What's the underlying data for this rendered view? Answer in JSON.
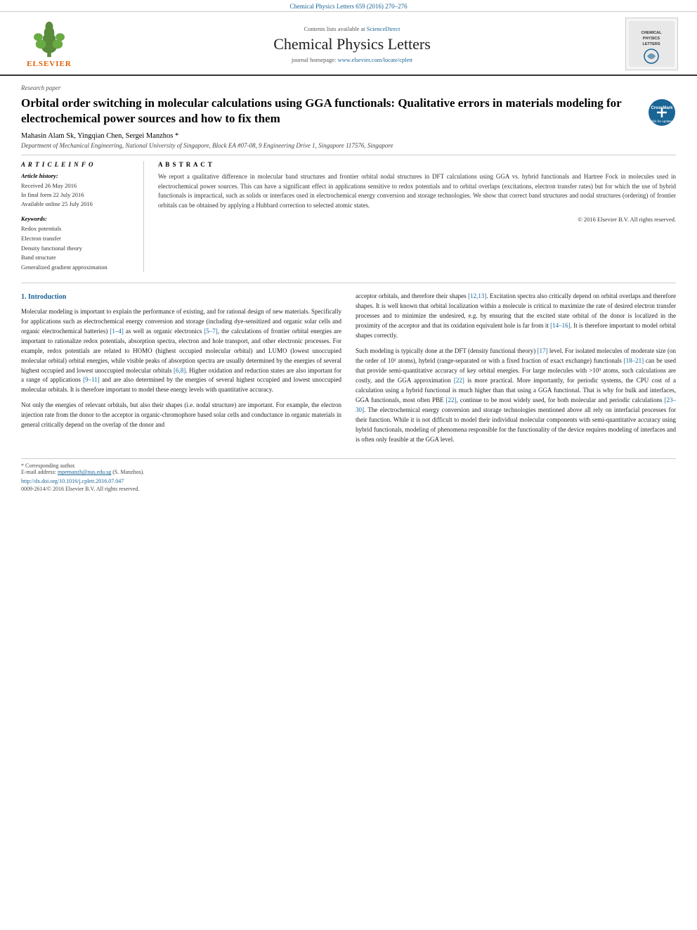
{
  "top_bar": {
    "journal_ref": "Chemical Physics Letters 659 (2016) 270–276"
  },
  "journal_header": {
    "contents_note": "Contents lists available at",
    "science_direct_link": "ScienceDirect",
    "journal_title": "Chemical Physics Letters",
    "homepage_label": "journal homepage:",
    "homepage_url": "www.elsevier.com/locate/cplett",
    "elsevier_brand": "ELSEVIER",
    "logo_alt": "CHEMICAL PHYSICS LETTERS"
  },
  "article": {
    "paper_type": "Research paper",
    "title": "Orbital order switching in molecular calculations using GGA functionals: Qualitative errors in materials modeling for electrochemical power sources and how to fix them",
    "authors": "Mahasin Alam Sk, Yingqian Chen, Sergei Manzhos *",
    "affiliation": "Department of Mechanical Engineering, National University of Singapore, Block EA #07-08, 9 Engineering Drive 1, Singapore 117576, Singapore"
  },
  "article_info": {
    "heading": "A R T I C L E   I N F O",
    "history_label": "Article history:",
    "received": "Received 26 May 2016",
    "final_form": "In final form 22 July 2016",
    "available": "Available online 25 July 2016",
    "keywords_label": "Keywords:",
    "keywords": [
      "Redox potentials",
      "Electron transfer",
      "Density functional theory",
      "Band structure",
      "Generalized gradient approximation"
    ]
  },
  "abstract": {
    "heading": "A B S T R A C T",
    "text": "We report a qualitative difference in molecular band structures and frontier orbital nodal structures in DFT calculations using GGA vs. hybrid functionals and Hartree Fock in molecules used in electrochemical power sources. This can have a significant effect in applications sensitive to redox potentials and to orbital overlaps (excitations, electron transfer rates) but for which the use of hybrid functionals is impractical, such as solids or interfaces used in electrochemical energy conversion and storage technologies. We show that correct band structures and nodal structures (ordering) of frontier orbitals can be obtained by applying a Hubbard correction to selected atomic states.",
    "copyright": "© 2016 Elsevier B.V. All rights reserved."
  },
  "body": {
    "section1_title": "1. Introduction",
    "col1_paragraphs": [
      "Molecular modeling is important to explain the performance of existing, and for rational design of new materials. Specifically for applications such as electrochemical energy conversion and storage (including dye-sensitized and organic solar cells and organic electrochemical batteries) [1–4] as well as organic electronics [5–7], the calculations of frontier orbital energies are important to rationalize redox potentials, absorption spectra, electron and hole transport, and other electronic processes. For example, redox potentials are related to HOMO (highest occupied molecular orbital) and LUMO (lowest unoccupied molecular orbital) orbital energies, while visible peaks of absorption spectra are usually determined by the energies of several highest occupied and lowest unoccupied molecular orbitals [6,8]. Higher oxidation and reduction states are also important for a range of applications [9–11] and are also determined by the energies of several highest occupied and lowest unoccupied molecular orbitals. It is therefore important to model these energy levels with quantitative accuracy.",
      "Not only the energies of relevant orbitals, but also their shapes (i.e. nodal structure) are important. For example, the electron injection rate from the donor to the acceptor in organic-chromophore based solar cells and conductance in organic materials in general critically depend on the overlap of the donor and"
    ],
    "col2_paragraphs": [
      "acceptor orbitals, and therefore their shapes [12,13]. Excitation spectra also critically depend on orbital overlaps and therefore shapes. It is well known that orbital localization within a molecule is critical to maximize the rate of desired electron transfer processes and to minimize the undesired, e.g. by ensuring that the excited state orbital of the donor is localized in the proximity of the acceptor and that its oxidation equivalent hole is far from it [14–16]. It is therefore important to model orbital shapes correctly.",
      "Such modeling is typically done at the DFT (density functional theory) [17] level. For isolated molecules of moderate size (on the order of 10² atoms), hybrid (range-separated or with a fixed fraction of exact exchange) functionals [18–21] can be used that provide semi-quantitative accuracy of key orbital energies. For large molecules with >10³ atoms, such calculations are costly, and the GGA approximation [22] is more practical. More importantly, for periodic systems, the CPU cost of a calculation using a hybrid functional is much higher than that using a GGA functional. That is why for bulk and interfaces, GGA functionals, most often PBE [22], continue to be most widely used, for both molecular and periodic calculations [23–30]. The electrochemical energy conversion and storage technologies mentioned above all rely on interfacial processes for their function. While it is not difficult to model their individual molecular components with semi-quantitative accuracy using hybrid functionals, modeling of phenomena responsible for the functionality of the device requires modeling of interfaces and is often only feasible at the GGA level."
    ]
  },
  "footnotes": {
    "corresponding": "* Corresponding author.",
    "email_label": "E-mail address:",
    "email": "mpemanzh@nus.edu.sg",
    "email_name": "(S. Manzhos).",
    "doi_url": "http://dx.doi.org/10.1016/j.cplett.2016.07.047",
    "issn": "0009-2614/© 2016 Elsevier B.V. All rights reserved."
  }
}
